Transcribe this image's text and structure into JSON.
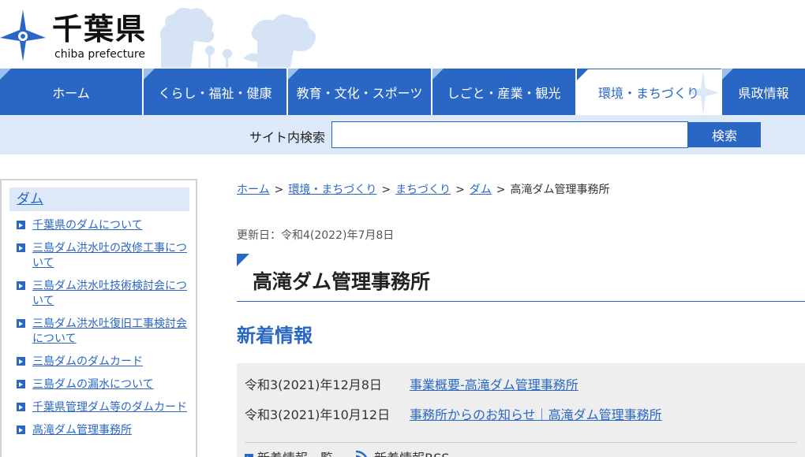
{
  "logo": {
    "title": "千葉県",
    "subtitle": "chiba prefecture"
  },
  "gnav": [
    {
      "label": "ホーム"
    },
    {
      "label": "くらし・福祉・健康"
    },
    {
      "label": "教育・文化・スポーツ"
    },
    {
      "label": "しごと・産業・観光"
    },
    {
      "label": "環境・まちづくり",
      "active": true
    },
    {
      "label": "県政情報"
    }
  ],
  "search": {
    "label": "サイト内検索",
    "placeholder": "",
    "value": "",
    "button": "検索"
  },
  "sidebar": {
    "heading": "ダム",
    "items": [
      "千葉県のダムについて",
      "三島ダム洪水吐の改修工事について",
      "三島ダム洪水吐技術検討会について",
      "三島ダム洪水吐復旧工事検討会について",
      "三島ダムのダムカード",
      "三島ダムの漏水について",
      "千葉県管理ダム等のダムカード",
      "高滝ダム管理事務所"
    ]
  },
  "breadcrumb": {
    "items": [
      "ホーム",
      "環境・まちづくり",
      "まちづくり",
      "ダム"
    ],
    "current": "高滝ダム管理事務所",
    "separator": ">"
  },
  "updated": "更新日：令和4(2022)年7月8日",
  "page_title": "高滝ダム管理事務所",
  "news": {
    "heading": "新着情報",
    "items": [
      {
        "date": "令和3(2021)年12月8日",
        "title": "事業概要-高滝ダム管理事務所"
      },
      {
        "date": "令和3(2021)年10月12日",
        "title": "事務所からのお知らせ｜高滝ダム管理事務所"
      }
    ],
    "list_link": "新着情報一覧",
    "rss_link": "新着情報RSS"
  },
  "colors": {
    "accent": "#2a66c4",
    "nav_light": "#dde8f8",
    "news_bg": "#eeeeee"
  },
  "icons": {
    "logo": "chiba-star-logo-icon",
    "rss": "rss-icon",
    "arrow": "arrow-right-icon"
  }
}
